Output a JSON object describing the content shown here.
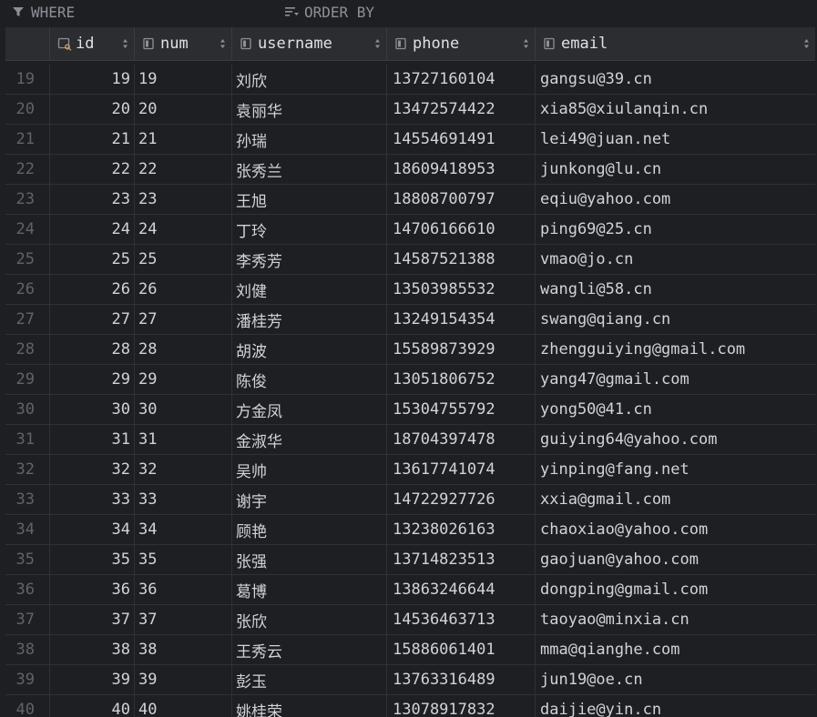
{
  "filter_bar": {
    "where_label": "WHERE",
    "order_by_label": "ORDER BY"
  },
  "columns": [
    {
      "key": "id",
      "label": "id"
    },
    {
      "key": "num",
      "label": "num"
    },
    {
      "key": "username",
      "label": "username"
    },
    {
      "key": "phone",
      "label": "phone"
    },
    {
      "key": "email",
      "label": "email"
    }
  ],
  "rows": [
    {
      "rownum": "19",
      "id": "19",
      "num": "19",
      "username": "刘欣",
      "phone": "13727160104",
      "email": "gangsu@39.cn"
    },
    {
      "rownum": "20",
      "id": "20",
      "num": "20",
      "username": "袁丽华",
      "phone": "13472574422",
      "email": "xia85@xiulanqin.cn"
    },
    {
      "rownum": "21",
      "id": "21",
      "num": "21",
      "username": "孙瑞",
      "phone": "14554691491",
      "email": "lei49@juan.net"
    },
    {
      "rownum": "22",
      "id": "22",
      "num": "22",
      "username": "张秀兰",
      "phone": "18609418953",
      "email": "junkong@lu.cn"
    },
    {
      "rownum": "23",
      "id": "23",
      "num": "23",
      "username": "王旭",
      "phone": "18808700797",
      "email": "eqiu@yahoo.com"
    },
    {
      "rownum": "24",
      "id": "24",
      "num": "24",
      "username": "丁玲",
      "phone": "14706166610",
      "email": "ping69@25.cn"
    },
    {
      "rownum": "25",
      "id": "25",
      "num": "25",
      "username": "李秀芳",
      "phone": "14587521388",
      "email": "vmao@jo.cn"
    },
    {
      "rownum": "26",
      "id": "26",
      "num": "26",
      "username": "刘健",
      "phone": "13503985532",
      "email": "wangli@58.cn"
    },
    {
      "rownum": "27",
      "id": "27",
      "num": "27",
      "username": "潘桂芳",
      "phone": "13249154354",
      "email": "swang@qiang.cn"
    },
    {
      "rownum": "28",
      "id": "28",
      "num": "28",
      "username": "胡波",
      "phone": "15589873929",
      "email": "zhengguiying@gmail.com"
    },
    {
      "rownum": "29",
      "id": "29",
      "num": "29",
      "username": "陈俊",
      "phone": "13051806752",
      "email": "yang47@gmail.com"
    },
    {
      "rownum": "30",
      "id": "30",
      "num": "30",
      "username": "方金凤",
      "phone": "15304755792",
      "email": "yong50@41.cn"
    },
    {
      "rownum": "31",
      "id": "31",
      "num": "31",
      "username": "金淑华",
      "phone": "18704397478",
      "email": "guiying64@yahoo.com"
    },
    {
      "rownum": "32",
      "id": "32",
      "num": "32",
      "username": "吴帅",
      "phone": "13617741074",
      "email": "yinping@fang.net"
    },
    {
      "rownum": "33",
      "id": "33",
      "num": "33",
      "username": "谢宇",
      "phone": "14722927726",
      "email": "xxia@gmail.com"
    },
    {
      "rownum": "34",
      "id": "34",
      "num": "34",
      "username": "顾艳",
      "phone": "13238026163",
      "email": "chaoxiao@yahoo.com"
    },
    {
      "rownum": "35",
      "id": "35",
      "num": "35",
      "username": "张强",
      "phone": "13714823513",
      "email": "gaojuan@yahoo.com"
    },
    {
      "rownum": "36",
      "id": "36",
      "num": "36",
      "username": "葛博",
      "phone": "13863246644",
      "email": "dongping@gmail.com"
    },
    {
      "rownum": "37",
      "id": "37",
      "num": "37",
      "username": "张欣",
      "phone": "14536463713",
      "email": "taoyao@minxia.cn"
    },
    {
      "rownum": "38",
      "id": "38",
      "num": "38",
      "username": "王秀云",
      "phone": "15886061401",
      "email": "mma@qianghe.com"
    },
    {
      "rownum": "39",
      "id": "39",
      "num": "39",
      "username": "彭玉",
      "phone": "13763316489",
      "email": "jun19@oe.cn"
    },
    {
      "rownum": "40",
      "id": "40",
      "num": "40",
      "username": "姚桂荣",
      "phone": "13078917832",
      "email": "daijie@yin.cn"
    }
  ],
  "colors": {
    "background": "#1e1f22",
    "header": "#2b2d30",
    "text": "#d0d3d9",
    "rownum": "#5f636b"
  }
}
